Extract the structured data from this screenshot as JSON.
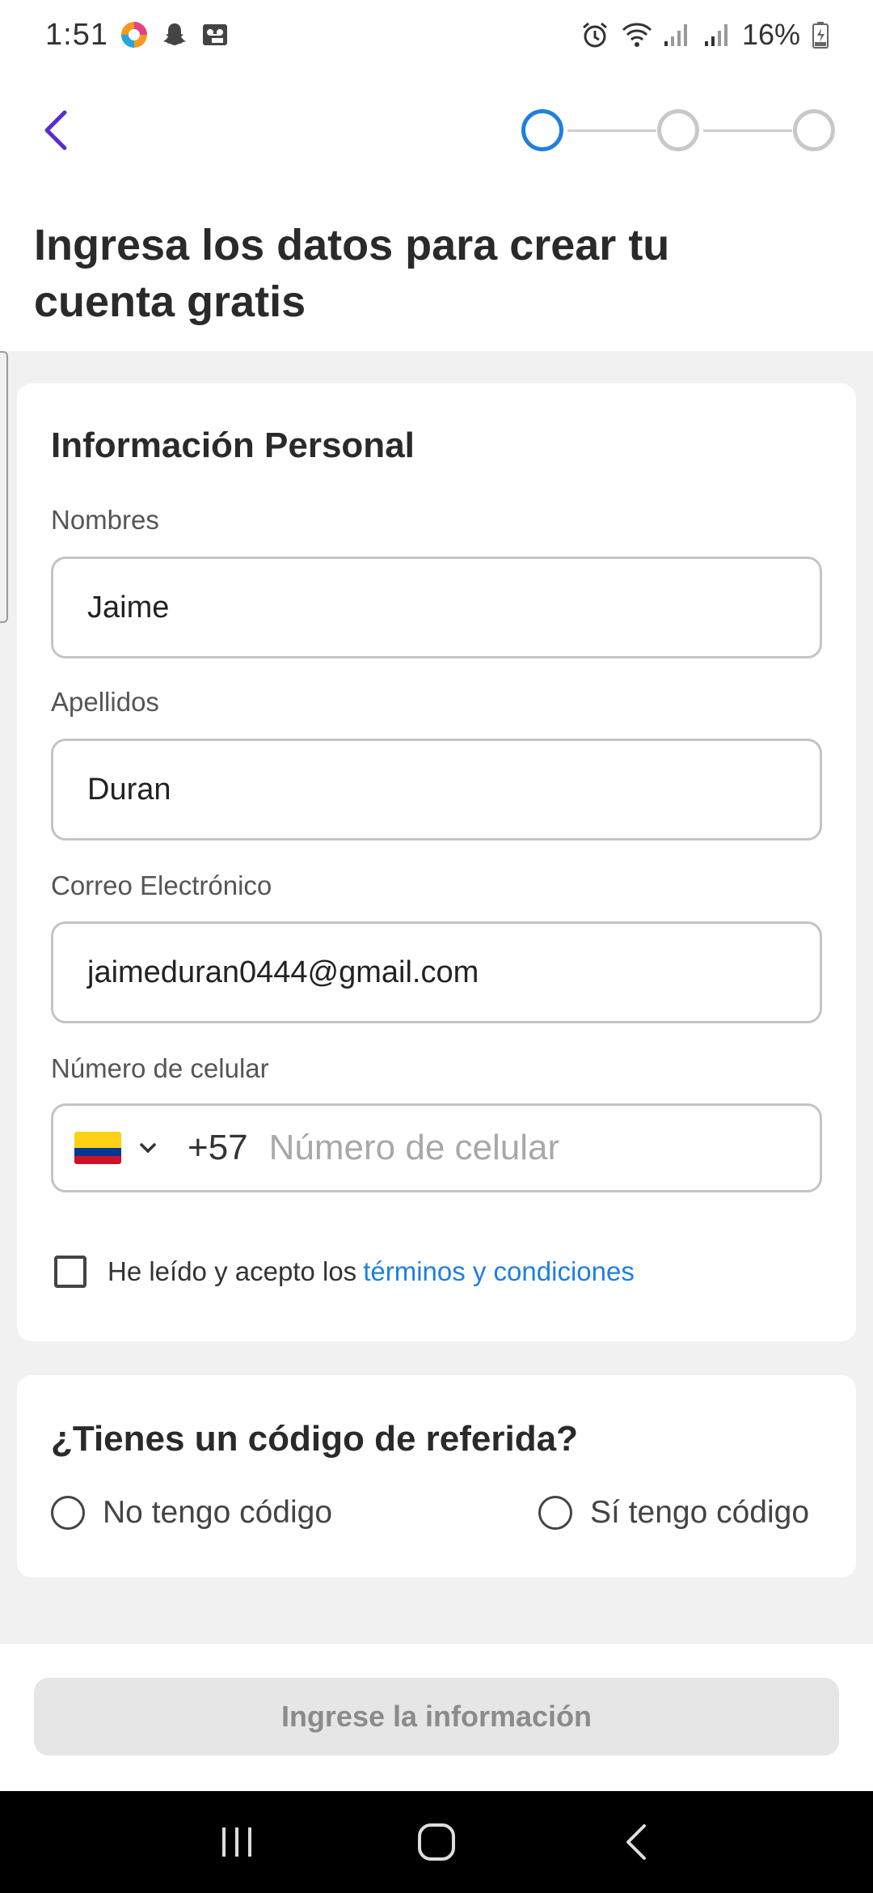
{
  "status_bar": {
    "time": "1:51",
    "battery": "16%",
    "icons_left": [
      "app-icon",
      "snapchat-icon",
      "voicemail-icon"
    ],
    "icons_right": [
      "alarm-icon",
      "wifi-icon",
      "signal-icon",
      "signal-icon",
      "battery-icon"
    ]
  },
  "header": {
    "back_icon": "chevron-left-icon",
    "steps_total": 3,
    "current_step": 1,
    "title": "Ingresa los datos para crear tu cuenta gratis"
  },
  "personal_info": {
    "title": "Información Personal",
    "first_name": {
      "label": "Nombres",
      "value": "Jaime"
    },
    "last_name": {
      "label": "Apellidos",
      "value": "Duran"
    },
    "email": {
      "label": "Correo Electrónico",
      "value": "jaimeduran0444@gmail.com"
    },
    "phone": {
      "label": "Número de celular",
      "country_flag": "Colombia",
      "dial_code": "+57",
      "placeholder": "Número de celular",
      "value": ""
    },
    "terms": {
      "text": "He leído y acepto los",
      "link": "términos y condiciones",
      "checked": false
    }
  },
  "referral": {
    "title": "¿Tienes un código de referida?",
    "options": [
      {
        "label": "No tengo código",
        "selected": false
      },
      {
        "label": "Sí tengo código",
        "selected": false
      }
    ]
  },
  "submit": {
    "label": "Ingrese la información",
    "enabled": false
  },
  "colors": {
    "accent_blue": "#1f7fe0",
    "back_purple": "#5b2bd1",
    "button_disabled_bg": "#e6e6e6",
    "button_disabled_text": "#8b8b8b"
  },
  "nav_bar": {
    "buttons": [
      "recent-apps-icon",
      "home-icon",
      "back-icon"
    ]
  }
}
